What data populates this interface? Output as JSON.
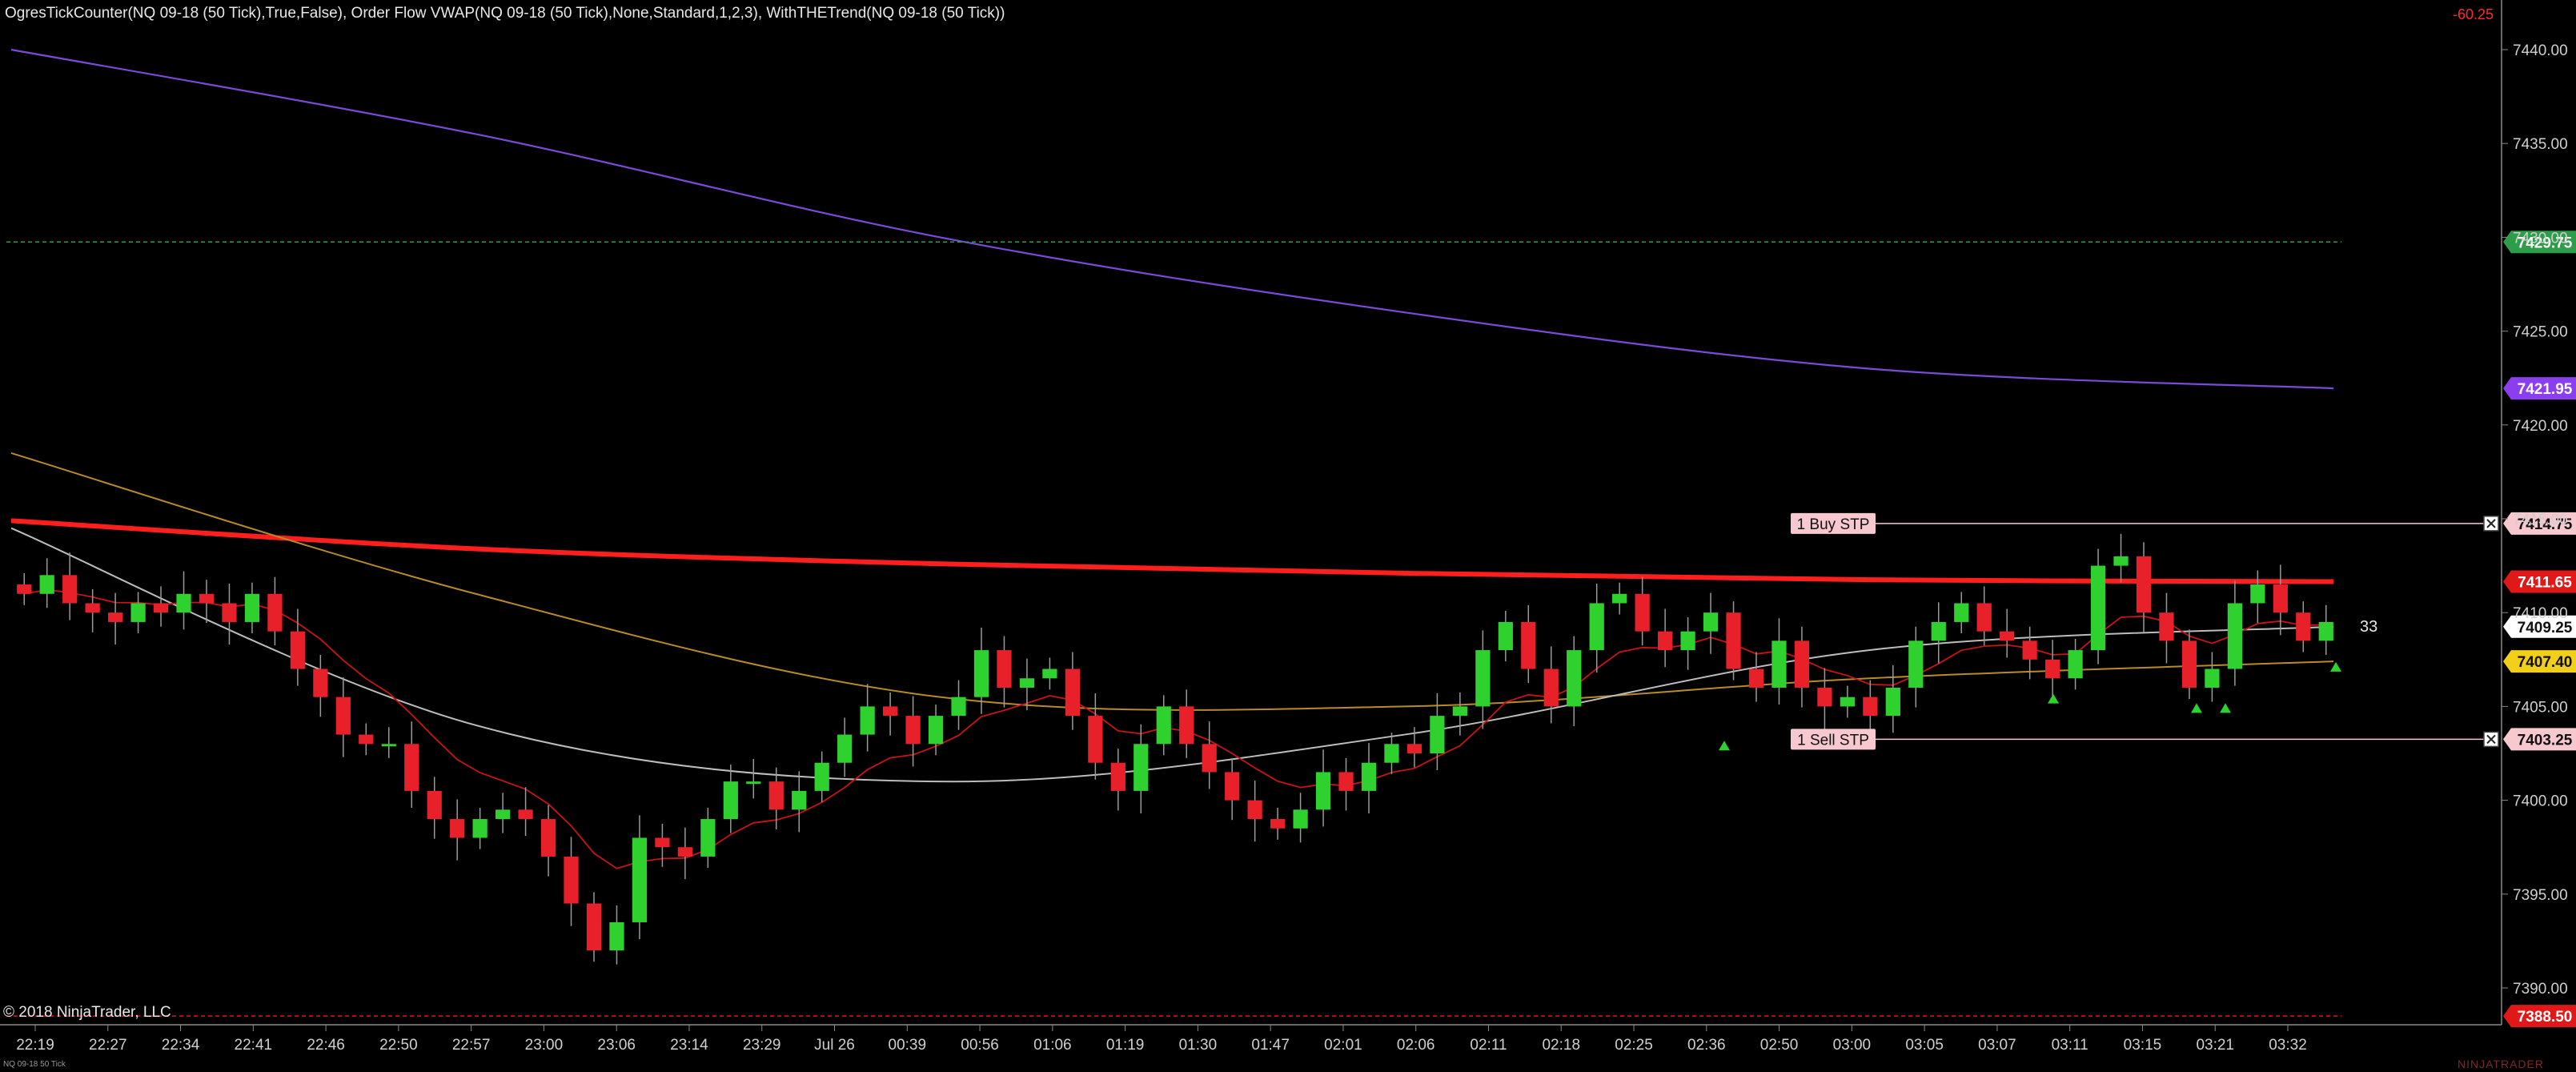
{
  "header": {
    "indicator_line": "OgresTickCounter(NQ 09-18 (50 Tick),True,False), Order Flow VWAP(NQ 09-18 (50 Tick),None,Standard,1,2,3), WithTHETrend(NQ 09-18 (50 Tick))",
    "pnl": "-60.25"
  },
  "footer": {
    "copyright": "© 2018 NinjaTrader, LLC",
    "instrument_small": "NQ 09-18 50 Tick",
    "brand": "NINJATRADER"
  },
  "tick_counter": "33",
  "colors": {
    "background": "#000000",
    "bull": "#2fd12f",
    "bear": "#e8202a",
    "vwap_purple": "#7a4ad8",
    "sma_red": "#ff1e1e",
    "sma_gold": "#b98a2a",
    "sma_gray": "#bdbdbd",
    "ema_red": "#c81414"
  },
  "chart_data": {
    "type": "candlestick",
    "instrument": "NQ 09-18 (50 Tick)",
    "ylim": [
      7388,
      7442
    ],
    "y_ticks": [
      "7440.00",
      "7435.00",
      "7430.00",
      "7425.00",
      "7420.00",
      "7415.00",
      "7410.00",
      "7405.00",
      "7400.00",
      "7395.00",
      "7390.00"
    ],
    "x_labels": [
      "22:19",
      "22:27",
      "22:34",
      "22:41",
      "22:46",
      "22:50",
      "22:57",
      "23:00",
      "23:06",
      "23:14",
      "23:29",
      "Jul 26",
      "00:39",
      "00:56",
      "01:06",
      "01:19",
      "01:30",
      "01:47",
      "02:01",
      "02:06",
      "02:11",
      "02:18",
      "02:25",
      "02:36",
      "02:50",
      "03:00",
      "03:05",
      "03:07",
      "03:11",
      "03:15",
      "03:21",
      "03:32"
    ],
    "closes": [
      7411.0,
      7412.0,
      7410.5,
      7410.0,
      7409.5,
      7410.5,
      7410.0,
      7411.0,
      7410.5,
      7409.5,
      7411.0,
      7409.0,
      7407.0,
      7405.5,
      7403.5,
      7403.0,
      7403.0,
      7400.5,
      7399.0,
      7398.0,
      7399.0,
      7399.5,
      7399.0,
      7397.0,
      7394.5,
      7392.0,
      7393.5,
      7398.0,
      7397.5,
      7397.0,
      7399.0,
      7401.0,
      7401.0,
      7399.5,
      7400.5,
      7402.0,
      7403.5,
      7405.0,
      7404.5,
      7403.0,
      7404.5,
      7405.5,
      7408.0,
      7406.0,
      7406.5,
      7407.0,
      7404.5,
      7402.0,
      7400.5,
      7403.0,
      7405.0,
      7403.0,
      7401.5,
      7400.0,
      7399.0,
      7398.5,
      7399.5,
      7401.5,
      7400.5,
      7402.0,
      7403.0,
      7402.5,
      7404.5,
      7405.0,
      7408.0,
      7409.5,
      7407.0,
      7405.0,
      7408.0,
      7410.5,
      7411.0,
      7409.0,
      7408.0,
      7409.0,
      7410.0,
      7407.0,
      7406.0,
      7408.5,
      7406.0,
      7405.0,
      7405.5,
      7404.5,
      7406.0,
      7408.5,
      7409.5,
      7410.5,
      7409.0,
      7408.5,
      7407.5,
      7406.5,
      7408.0,
      7412.5,
      7413.0,
      7410.0,
      7408.5,
      7406.0,
      7407.0,
      7410.5,
      7411.5,
      7410.0,
      7408.5,
      7409.5
    ],
    "series": [
      {
        "name": "",
        "type": "line",
        "values": [
          7440.0,
          7435.5,
          7430.0,
          7426.0,
          7423.0,
          7421.95
        ]
      },
      {
        "name": "",
        "type": "line",
        "values": [
          7414.9,
          7413.4,
          7412.6,
          7412.1,
          7411.75,
          7411.65
        ]
      },
      {
        "name": "",
        "type": "line",
        "values": [
          7418.5,
          7411.0,
          7405.5,
          7405.0,
          7406.5,
          7407.4
        ]
      },
      {
        "name": "",
        "type": "line",
        "values": [
          7414.5,
          7404.0,
          7401.0,
          7403.5,
          7408.0,
          7409.25
        ]
      }
    ],
    "price_markers": [
      {
        "label": "7429.75",
        "value": 7429.75,
        "color": "#2e9d4a",
        "line": "dashed"
      },
      {
        "label": "7421.95",
        "value": 7421.95,
        "color": "#8a3ef0"
      },
      {
        "label": "7414.75",
        "value": 7414.75,
        "color": "#f7c9cf",
        "order": "1 Buy STP"
      },
      {
        "label": "7411.65",
        "value": 7411.65,
        "color": "#e01818"
      },
      {
        "label": "7409.25",
        "value": 7409.25,
        "color": "#ffffff"
      },
      {
        "label": "7407.40",
        "value": 7407.4,
        "color": "#f2d01a"
      },
      {
        "label": "7403.25",
        "value": 7403.25,
        "color": "#f7c9cf",
        "order": "1 Sell STP"
      },
      {
        "label": "7388.50",
        "value": 7388.5,
        "color": "#e01818",
        "line": "dashed"
      }
    ],
    "orders": [
      "1 Buy STP",
      "1 Sell STP"
    ]
  }
}
